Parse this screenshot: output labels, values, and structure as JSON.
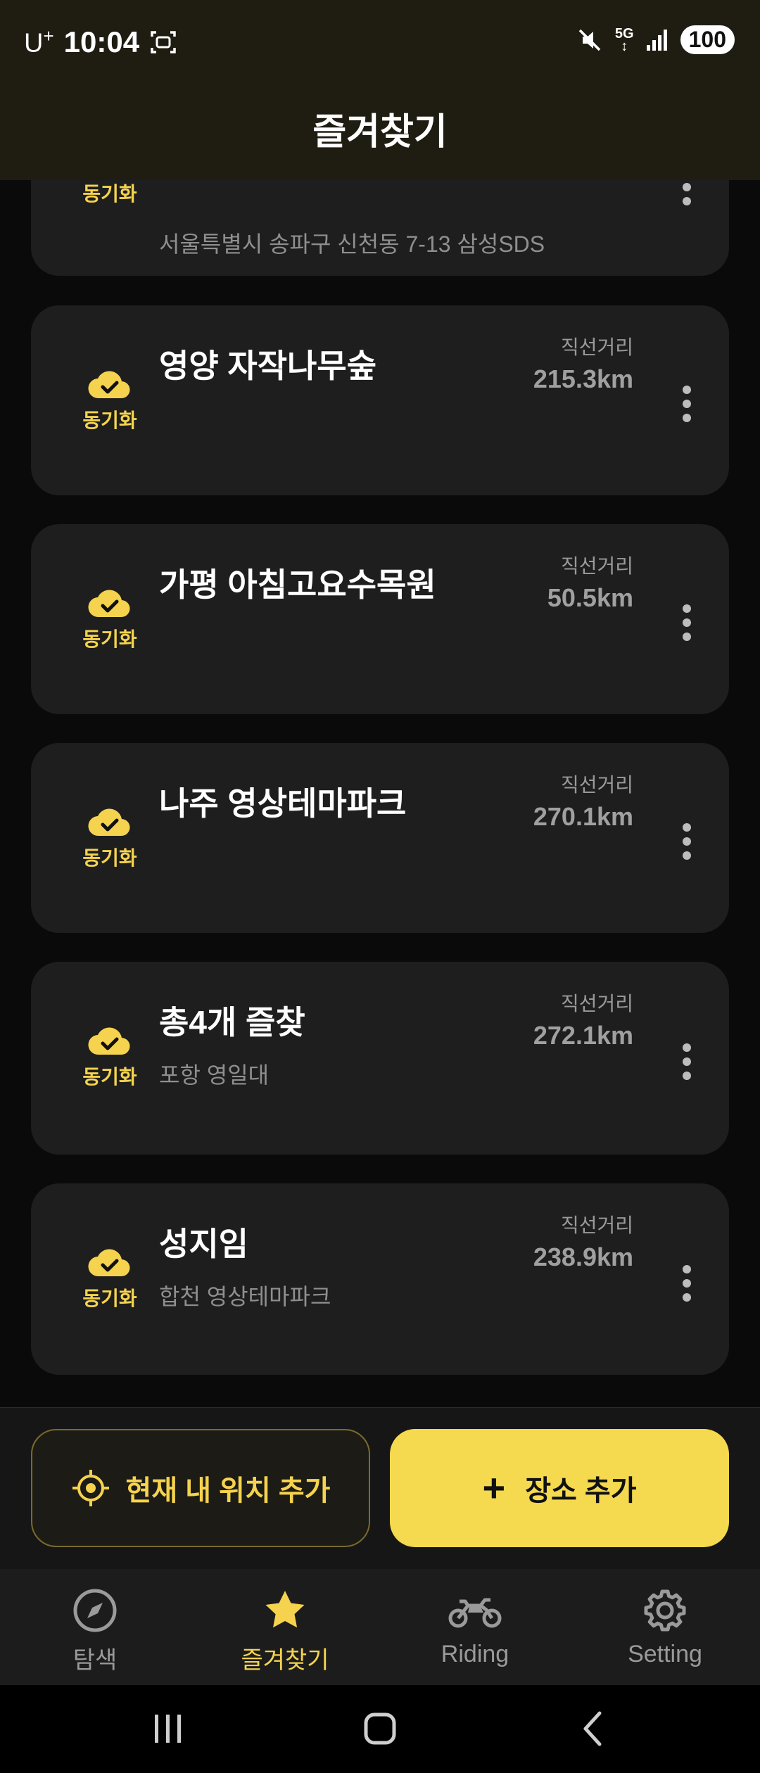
{
  "status": {
    "carrier": "U",
    "carrier_sup": "+",
    "time": "10:04",
    "network": "5G",
    "battery": "100"
  },
  "appbar": {
    "title": "즐겨찾기"
  },
  "sync_label": "동기화",
  "distance_label": "직선거리",
  "favorites": [
    {
      "name": "",
      "address": "서울특별시 송파구 신천동 7-13 삼성SDS",
      "distance": ""
    },
    {
      "name": "영양 자작나무숲",
      "address": "",
      "distance": "215.3km"
    },
    {
      "name": "가평 아침고요수목원",
      "address": "",
      "distance": "50.5km"
    },
    {
      "name": "나주 영상테마파크",
      "address": "",
      "distance": "270.1km"
    },
    {
      "name": "총4개 즐찾",
      "address": "포항 영일대",
      "distance": "272.1km"
    },
    {
      "name": "성지임",
      "address": "합천 영상테마파크",
      "distance": "238.9km"
    }
  ],
  "actions": {
    "add_current_location": "현재 내 위치 추가",
    "add_place": "장소 추가"
  },
  "bottom_nav": [
    {
      "label": "탐색",
      "icon": "compass-icon",
      "active": false
    },
    {
      "label": "즐겨찾기",
      "icon": "star-icon",
      "active": true
    },
    {
      "label": "Riding",
      "icon": "motorcycle-icon",
      "active": false
    },
    {
      "label": "Setting",
      "icon": "gear-icon",
      "active": false
    }
  ],
  "colors": {
    "accent": "#f5d34e",
    "card": "#1e1e1e",
    "header": "#1f1c12"
  }
}
